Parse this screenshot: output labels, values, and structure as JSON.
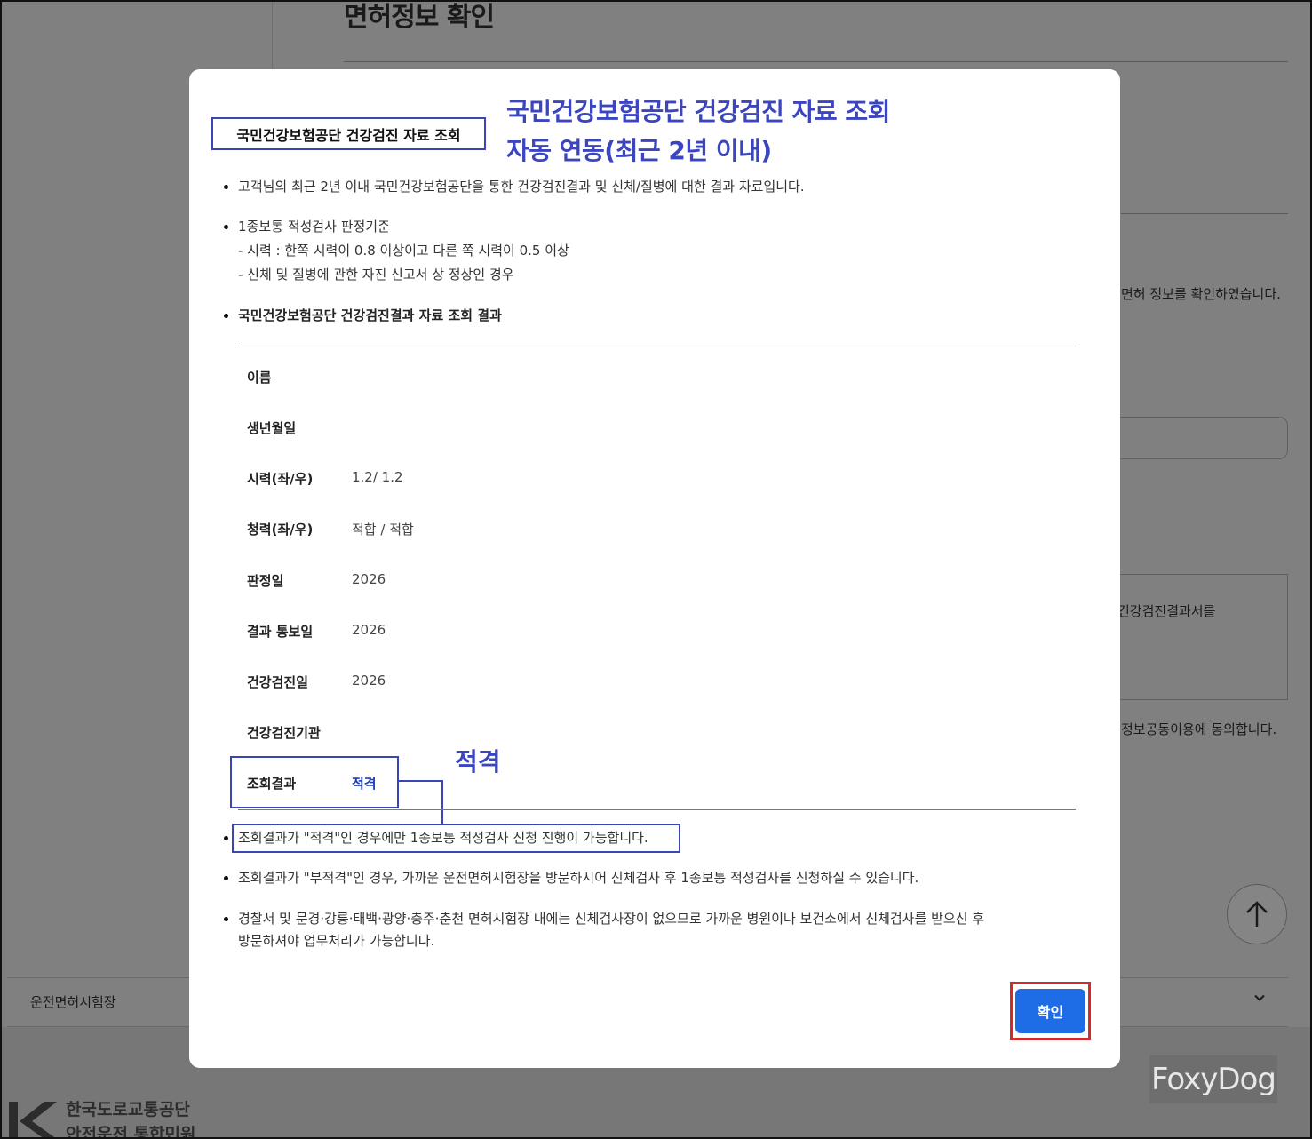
{
  "background": {
    "page_title": "면허정보 확인",
    "text_right_1": "면허 정보를 확인하였습니다.",
    "text_right_2": "건강검진결과서를",
    "text_right_3": "정보공동이용에 동의합니다.",
    "select_label": "운전면허시험장",
    "logo_line1": "한국도로교통공단",
    "logo_line2": "안전운전 통합민원",
    "watermark": "FoxyDog"
  },
  "modal": {
    "heading": "국민건강보험공단 건강검진 자료 조회",
    "annotation_line1": "국민건강보험공단 건강검진 자료 조회",
    "annotation_line2": "자동 연동(최근 2년 이내)",
    "annotation_result": "적격",
    "intro": "고객님의 최근 2년 이내 국민건강보험공단을 통한 건강검진결과 및 신체/질병에 대한 결과 자료입니다.",
    "criteria_title": "1종보통 적성검사 판정기준",
    "criteria_vision": "- 시력 : 한쪽 시력이 0.8 이상이고 다른 쪽 시력이 0.5 이상",
    "criteria_body": "- 신체 및 질병에 관한 자진 신고서 상 정상인 경우",
    "result_section_title": "국민건강보험공단 건강검진결과 자료 조회 결과",
    "rows": [
      {
        "label": "이름",
        "value": ""
      },
      {
        "label": "생년월일",
        "value": ""
      },
      {
        "label": "시력(좌/우)",
        "value": "1.2/ 1.2"
      },
      {
        "label": "청력(좌/우)",
        "value": "적합 / 적합"
      },
      {
        "label": "판정일",
        "value": "2026"
      },
      {
        "label": "결과 통보일",
        "value": "2026"
      },
      {
        "label": "건강검진일",
        "value": "2026"
      },
      {
        "label": "건강검진기관",
        "value": ""
      },
      {
        "label": "조회결과",
        "value": "적격"
      }
    ],
    "notes": [
      "조회결과가 \"적격\"인 경우에만 1종보통 적성검사 신청 진행이 가능합니다.",
      "조회결과가 \"부적격\"인 경우, 가까운 운전면허시험장을 방문하시어 신체검사 후 1종보통 적성검사를 신청하실 수 있습니다.",
      "경찰서 및 문경·강릉·태백·광양·충주·춘천 면허시험장 내에는 신체검사장이 없으므로 가까운 병원이나 보건소에서 신체검사를 받으신 후",
      "방문하셔야 업무처리가 가능합니다."
    ],
    "confirm_button": "확인"
  },
  "colors": {
    "annotation_blue": "#3b45c0",
    "confirm_button": "#1f6de6",
    "highlight_red": "#d42a2a",
    "result_value": "#1a3fb8"
  },
  "icons": {
    "scroll_top": "arrow-up-icon",
    "select": "chevron-down-icon"
  }
}
